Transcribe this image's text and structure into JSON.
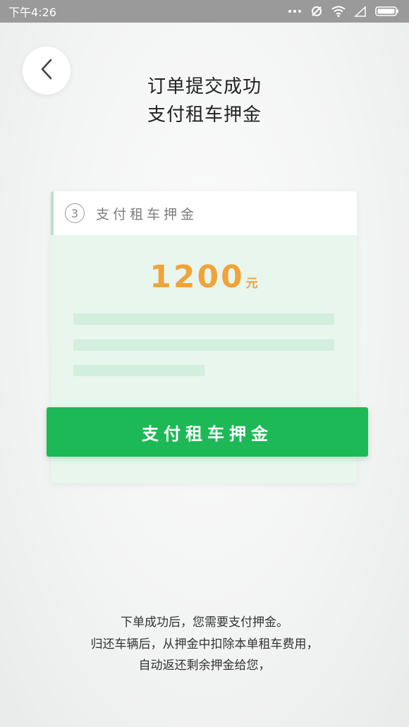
{
  "status_bar": {
    "time": "下午4:26"
  },
  "header": {
    "back_icon": "chevron-left-icon",
    "title_line1": "订单提交成功",
    "title_line2": "支付租车押金"
  },
  "card": {
    "step_number": "3",
    "step_label": "支付租车押金",
    "amount": "1200",
    "amount_unit": "元"
  },
  "pay_button": {
    "label": "支付租车押金"
  },
  "notes": {
    "line1": "下单成功后，您需要支付押金。",
    "line2": "归还车辆后，从押金中扣除本单租车费用，",
    "line3": "自动返还剩余押金给您，"
  },
  "colors": {
    "accent_green": "#1cb956",
    "amount_orange": "#f0a33a",
    "card_background": "#e8f6ee",
    "status_bar": "#9a9a9a"
  }
}
